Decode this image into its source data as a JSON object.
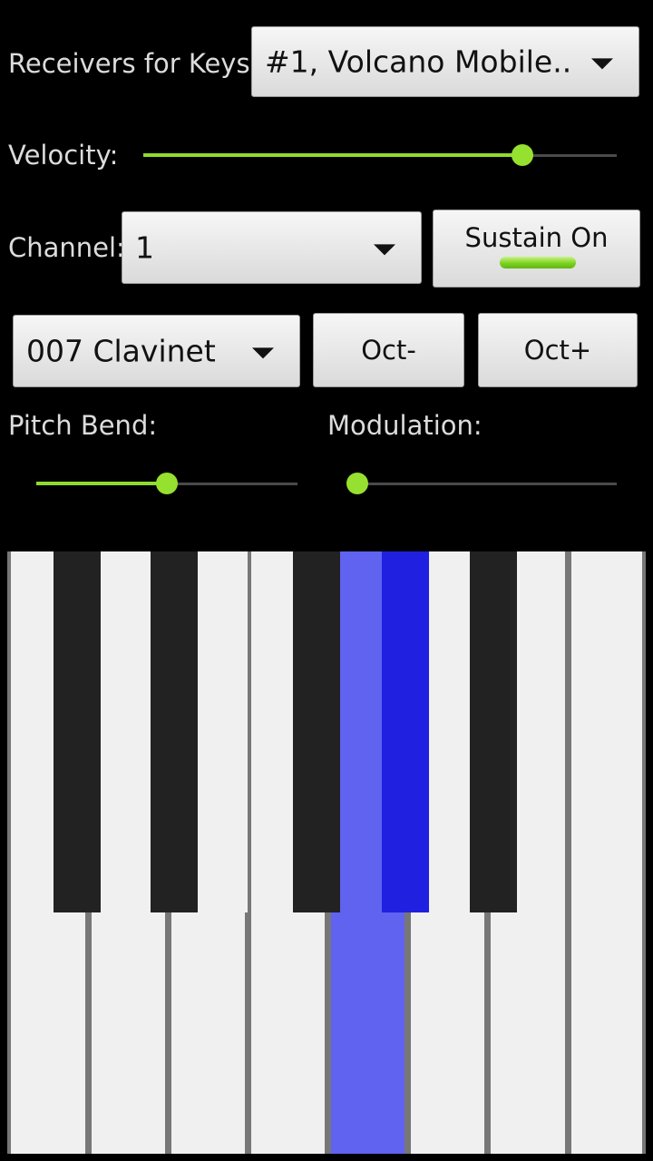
{
  "receivers": {
    "label": "Receivers for Keys:",
    "selected": "#1, Volcano Mobile.."
  },
  "velocity": {
    "label": "Velocity:",
    "value": 0.8
  },
  "channel": {
    "label": "Channel:",
    "selected": "1"
  },
  "sustain": {
    "label": "Sustain On",
    "on": true
  },
  "instrument": {
    "selected": "007 Clavinet"
  },
  "octave": {
    "down_label": "Oct-",
    "up_label": "Oct+"
  },
  "pitch_bend": {
    "label": "Pitch Bend:",
    "value": 0.5
  },
  "modulation": {
    "label": "Modulation:",
    "value": 0.0
  },
  "colors": {
    "accent": "#8fdc2c",
    "white_key": "#f0f0f0",
    "black_key": "#222222",
    "key_separator": "#777777",
    "pressed_white": "#5f63f0",
    "pressed_black": "#2020e0"
  },
  "keyboard": {
    "white_keys": [
      {
        "note": "C",
        "pressed": false
      },
      {
        "note": "D",
        "pressed": false
      },
      {
        "note": "E",
        "pressed": false
      },
      {
        "note": "F",
        "pressed": false
      },
      {
        "note": "G",
        "pressed": true
      },
      {
        "note": "A",
        "pressed": false
      },
      {
        "note": "B",
        "pressed": false
      },
      {
        "note": "C",
        "pressed": false
      }
    ],
    "black_keys": [
      {
        "note": "C#",
        "pressed": false
      },
      {
        "note": "D#",
        "pressed": false
      },
      {
        "note": "F#",
        "pressed": false
      },
      {
        "note": "G#",
        "pressed": true
      },
      {
        "note": "A#",
        "pressed": false
      }
    ]
  }
}
